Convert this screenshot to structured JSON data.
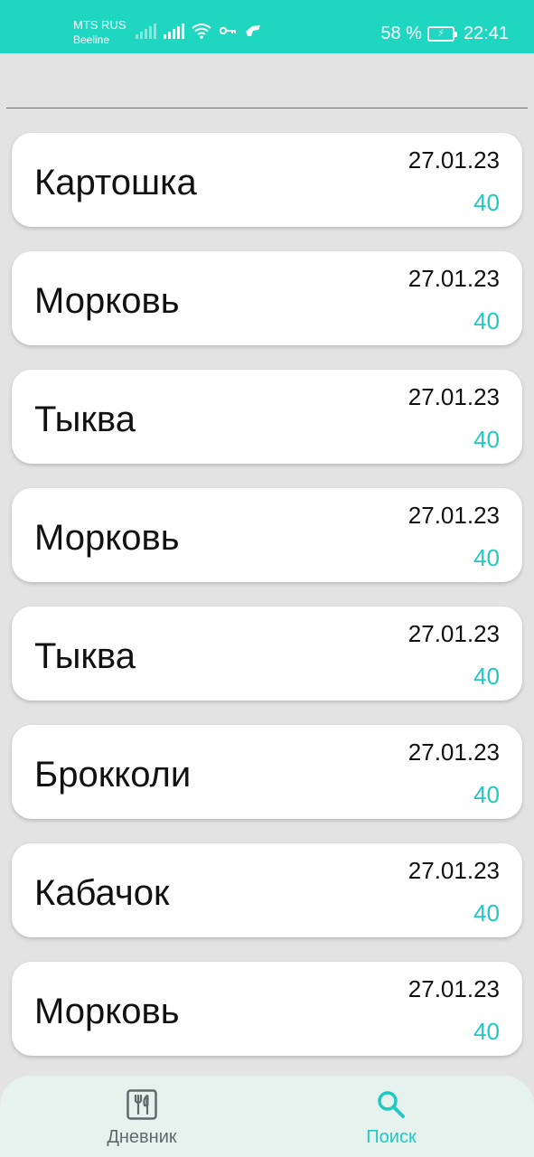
{
  "status_bar": {
    "carrier_1": "MTS RUS",
    "carrier_2": "Beeline",
    "battery_percent": "58 %",
    "time": "22:41",
    "icons": [
      "signal-icon",
      "signal-icon",
      "wifi-icon",
      "vpn-key-icon",
      "nfc-icon",
      "battery-charging-icon"
    ]
  },
  "colors": {
    "accent": "#1fd6c0",
    "value_text": "#1fc9c4",
    "nav_inactive": "#5f6b6a",
    "nav_active": "#1fc9c4"
  },
  "items": [
    {
      "name": "Картошка",
      "date": "27.01.23",
      "value": "40"
    },
    {
      "name": "Морковь",
      "date": "27.01.23",
      "value": "40"
    },
    {
      "name": "Тыква",
      "date": "27.01.23",
      "value": "40"
    },
    {
      "name": "Морковь",
      "date": "27.01.23",
      "value": "40"
    },
    {
      "name": "Тыква",
      "date": "27.01.23",
      "value": "40"
    },
    {
      "name": "Брокколи",
      "date": "27.01.23",
      "value": "40"
    },
    {
      "name": "Кабачок",
      "date": "27.01.23",
      "value": "40"
    },
    {
      "name": "Морковь",
      "date": "27.01.23",
      "value": "40"
    }
  ],
  "nav": {
    "diary_label": "Дневник",
    "diary_icon": "cutlery-icon",
    "search_label": "Поиск",
    "search_icon": "search-icon",
    "active": "search"
  }
}
